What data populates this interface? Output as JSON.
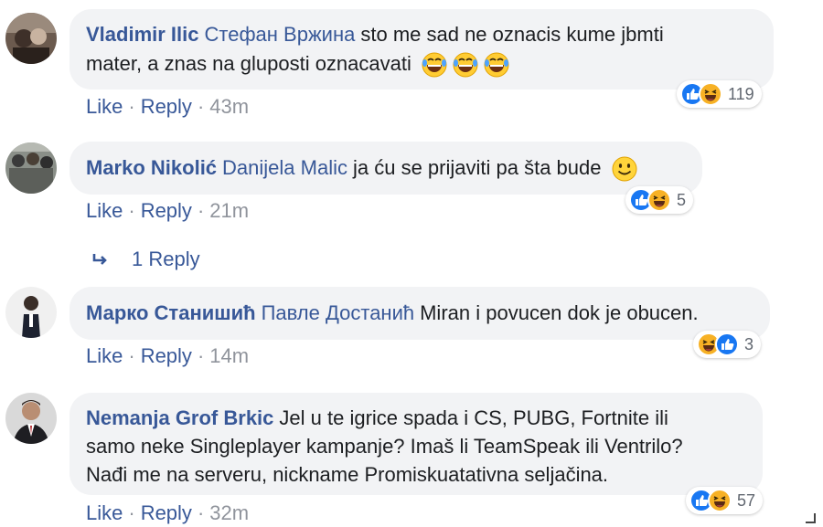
{
  "comments": [
    {
      "author": "Vladimir Ilic",
      "mention": "Стефан Вржина",
      "text_line1": "sto me sad ne oznacis kume jbmti",
      "text_line2": "mater, a znas na gluposti oznacavati",
      "emoji": [
        "laugh-cry-emoji",
        "laugh-cry-emoji",
        "laugh-cry-emoji"
      ],
      "actions": {
        "like": "Like",
        "reply": "Reply",
        "time": "43m"
      },
      "reactions": {
        "icons": [
          "like-reaction-icon",
          "haha-reaction-icon"
        ],
        "count": "119"
      }
    },
    {
      "author": "Marko Nikolić",
      "mention": "Danijela Malic",
      "text_line1": "ja ću se prijaviti pa šta bude",
      "emoji": [
        "smile-emoji"
      ],
      "actions": {
        "like": "Like",
        "reply": "Reply",
        "time": "21m"
      },
      "reactions": {
        "icons": [
          "like-reaction-icon",
          "haha-reaction-icon"
        ],
        "count": "5"
      },
      "replies_label": "1 Reply"
    },
    {
      "author": "Марко Станишић",
      "mention": "Павле Достанић",
      "text_line1": "Miran i povucen dok je obucen.",
      "actions": {
        "like": "Like",
        "reply": "Reply",
        "time": "14m"
      },
      "reactions": {
        "icons": [
          "haha-reaction-icon",
          "like-reaction-icon"
        ],
        "count": "3"
      }
    },
    {
      "author": "Nemanja Grof Brkic",
      "text_line1": "Jel u te igrice spada i CS, PUBG, Fortnite ili",
      "text_line2": "samo neke Singleplayer kampanje? Imaš li TeamSpeak ili Ventrilo?",
      "text_line3": "Nađi me na serveru, nickname Promiskuatativna seljačina.",
      "actions": {
        "like": "Like",
        "reply": "Reply",
        "time": "32m"
      },
      "reactions": {
        "icons": [
          "like-reaction-icon",
          "haha-reaction-icon"
        ],
        "count": "57"
      }
    }
  ],
  "colors": {
    "link": "#385898",
    "bubble": "#f2f3f5",
    "meta": "#90949c",
    "like_blue": "#1877f2",
    "haha_yellow": "#f7b125"
  },
  "separator": "·"
}
